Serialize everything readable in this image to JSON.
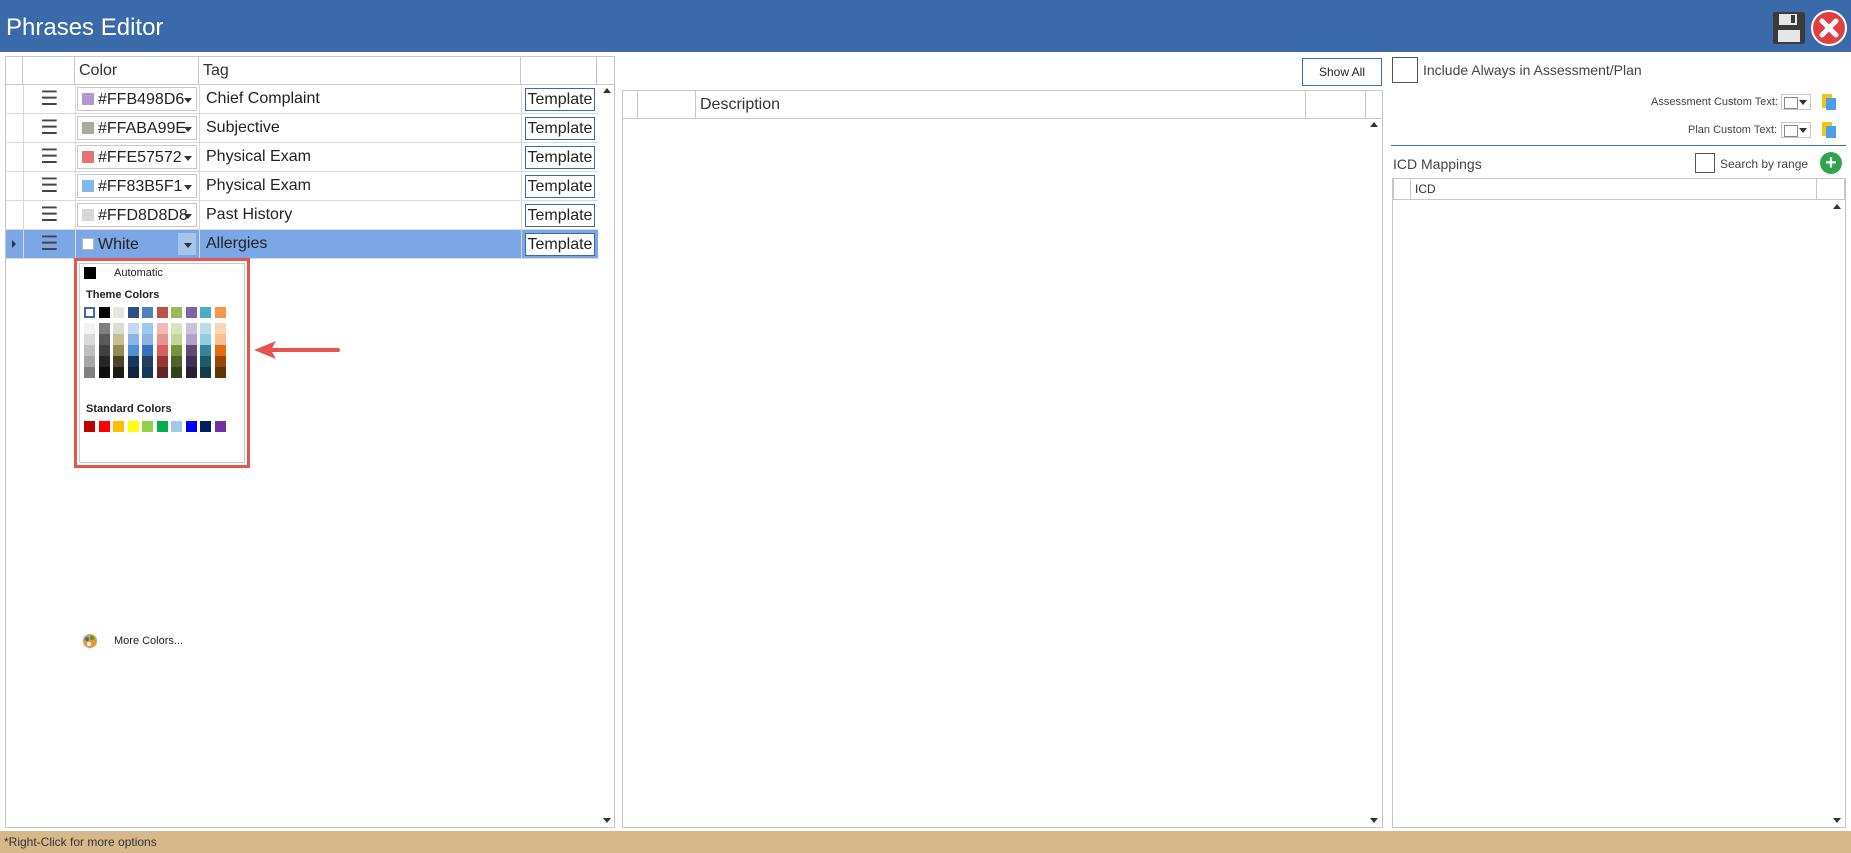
{
  "window": {
    "title": "Phrases Editor"
  },
  "grid": {
    "headers": {
      "color": "Color",
      "tag": "Tag"
    },
    "rows": [
      {
        "color_value": "#FFB498D6",
        "swatch": "#b498d6",
        "tag": "Chief Complaint",
        "action": "Template"
      },
      {
        "color_value": "#FFABA99E",
        "swatch": "#aba99e",
        "tag": "Subjective",
        "action": "Template"
      },
      {
        "color_value": "#FFE57572",
        "swatch": "#e57572",
        "tag": "Physical Exam",
        "action": "Template"
      },
      {
        "color_value": "#FF83B5F1",
        "swatch": "#83b5f1",
        "tag": "Physical Exam",
        "action": "Template"
      },
      {
        "color_value": "#FFD8D8D8",
        "swatch": "#d8d8d8",
        "tag": "Past History",
        "action": "Template"
      },
      {
        "color_value": "White",
        "swatch": "#ffffff",
        "tag": "Allergies",
        "action": "Template",
        "selected": true
      }
    ]
  },
  "color_picker": {
    "automatic_label": "Automatic",
    "theme_colors_label": "Theme Colors",
    "standard_colors_label": "Standard Colors",
    "more_colors_label": "More Colors...",
    "theme_top": [
      "#ffffff",
      "#000000",
      "#e8e6dc",
      "#2c4f86",
      "#4f7fbf",
      "#c0504d",
      "#9bbb59",
      "#8064a2",
      "#4bacc6",
      "#f79646"
    ],
    "theme_shades": [
      [
        "#f2f2f2",
        "#d9d9d9",
        "#bfbfbf",
        "#a6a6a6",
        "#808080"
      ],
      [
        "#808080",
        "#595959",
        "#404040",
        "#262626",
        "#0d0d0d"
      ],
      [
        "#dddbd0",
        "#c4bd97",
        "#948a54",
        "#4a452a",
        "#1e1c11"
      ],
      [
        "#c6d9f1",
        "#8eb4e3",
        "#558ed5",
        "#17375e",
        "#0f243e"
      ],
      [
        "#9ec5f8",
        "#8db3e2",
        "#3672c0",
        "#244061",
        "#17365d"
      ],
      [
        "#f2b8b7",
        "#e6948f",
        "#d4615d",
        "#953735",
        "#632523"
      ],
      [
        "#d7e4bd",
        "#c3d69b",
        "#77933c",
        "#4f6228",
        "#32421a"
      ],
      [
        "#ccc1da",
        "#b3a2c7",
        "#604a7b",
        "#3f3151",
        "#271f34"
      ],
      [
        "#b7dde8",
        "#93cddd",
        "#31859c",
        "#215968",
        "#133c47"
      ],
      [
        "#fcd5b5",
        "#fac090",
        "#e46c0a",
        "#984807",
        "#603205"
      ]
    ],
    "standard": [
      "#c00000",
      "#ff0000",
      "#ffc000",
      "#ffff00",
      "#92d050",
      "#00b050",
      "#9ecbe8",
      "#0000ff",
      "#002060",
      "#7030a0"
    ]
  },
  "middle": {
    "show_all_label": "Show All",
    "description_header": "Description"
  },
  "right": {
    "include_always_label": "Include Always in Assessment/Plan",
    "assessment_custom_text_label": "Assessment Custom Text:",
    "plan_custom_text_label": "Plan Custom Text:",
    "icd_mappings_label": "ICD Mappings",
    "search_by_range_label": "Search by range",
    "icd_header": "ICD"
  },
  "status": {
    "hint": "*Right-Click for more options"
  }
}
